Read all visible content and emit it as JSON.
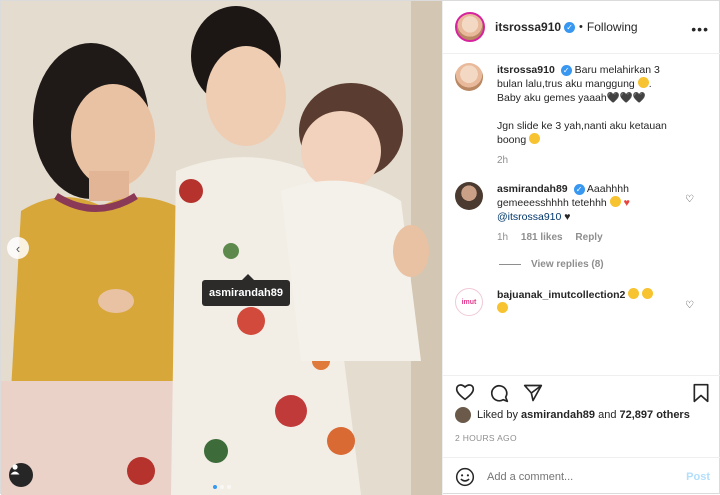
{
  "header": {
    "username": "itsrossa910",
    "separator": "•",
    "follow_status": "Following"
  },
  "photo": {
    "tag_label": "asmirandah89"
  },
  "caption": {
    "username": "itsrossa910",
    "text1": "Baru melahirkan 3 bulan lalu,trus aku manggung",
    "text2": "Baby aku gemes yaaah🖤🖤🖤",
    "text3": "Jgn slide ke 3 yah,nanti aku ketauan boong",
    "time": "2h"
  },
  "comments": [
    {
      "username": "asmirandah89",
      "text": "Aaahhhh gemeeesshhhh tetehhh",
      "mention": "@itsrossa910",
      "time": "1h",
      "likes": "181 likes",
      "reply": "Reply",
      "view_replies": "View replies (8)"
    },
    {
      "username": "bajuanak_imutcollection2",
      "avatar_label": "imut"
    }
  ],
  "likes": {
    "prefix": "Liked by",
    "user": "asmirandah89",
    "and": "and",
    "others": "72,897 others"
  },
  "timestamp": "2 HOURS AGO",
  "composer": {
    "placeholder": "Add a comment...",
    "post_label": "Post"
  },
  "colors": {
    "accent": "#3897f0",
    "post_disabled": "#b2dffc",
    "muted": "#8e8e8e"
  }
}
